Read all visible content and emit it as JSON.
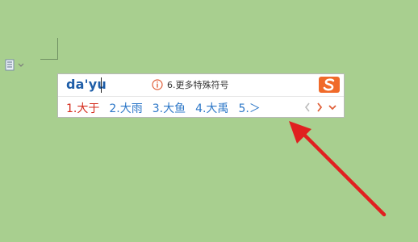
{
  "ime": {
    "pinyin": "da'yu",
    "hint": "6.更多特殊符号",
    "candidates": [
      {
        "label": "1.大于"
      },
      {
        "label": "2.大雨"
      },
      {
        "label": "3.大鱼"
      },
      {
        "label": "4.大禹"
      },
      {
        "label": "5.＞"
      }
    ]
  },
  "icons": {
    "paragraph": "paragraph-icon",
    "info": "info-icon",
    "logo": "sogou-logo-icon",
    "prev": "chevron-left-icon",
    "next": "chevron-right-icon",
    "expand": "chevron-down-icon",
    "arrow": "red-arrow-annotation"
  },
  "colors": {
    "background": "#a8cf8f",
    "selected_candidate": "#d42a1b",
    "candidate": "#2e78c8",
    "pinyin": "#1f5ea8",
    "logo": "#f06a2a",
    "arrow": "#e02020"
  }
}
